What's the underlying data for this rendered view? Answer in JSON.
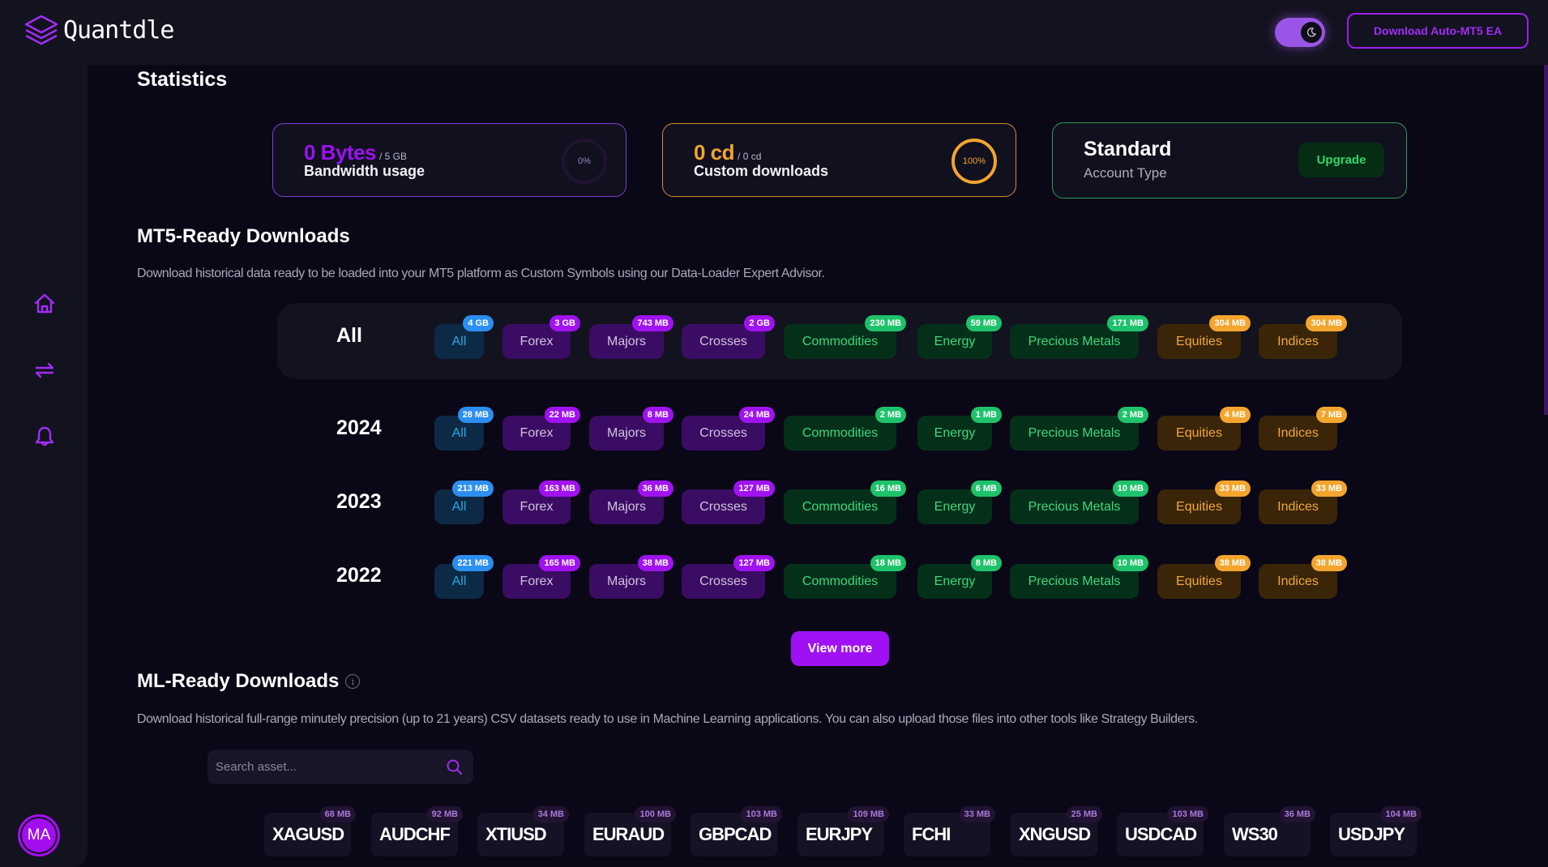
{
  "header": {
    "app_name": "Quantdle",
    "download_ea_label": "Download Auto-MT5 EA",
    "theme": "dark"
  },
  "sidebar": {
    "items": [
      {
        "icon": "home-icon"
      },
      {
        "icon": "transfer-icon"
      },
      {
        "icon": "bell-icon"
      }
    ],
    "avatar_initials": "MA"
  },
  "statistics": {
    "title": "Statistics",
    "bandwidth": {
      "value": "0 Bytes",
      "limit": "/ 5 GB",
      "label": "Bandwidth usage",
      "percent": "0%"
    },
    "custom_downloads": {
      "value": "0 cd",
      "limit": "/ 0 cd",
      "label": "Custom downloads",
      "percent": "100%"
    },
    "account": {
      "type": "Standard",
      "label": "Account Type",
      "upgrade_label": "Upgrade"
    }
  },
  "mt5": {
    "title": "MT5-Ready Downloads",
    "description": "Download historical data ready to be loaded into your MT5 platform as Custom Symbols using our Data-Loader Expert Advisor.",
    "categories": [
      "All",
      "Forex",
      "Majors",
      "Crosses",
      "Commodities",
      "Energy",
      "Precious Metals",
      "Equities",
      "Indices"
    ],
    "rows": [
      {
        "label": "All",
        "sizes": [
          "4 GB",
          "3 GB",
          "743 MB",
          "2 GB",
          "230 MB",
          "59 MB",
          "171 MB",
          "304 MB",
          "304 MB"
        ]
      },
      {
        "label": "2024",
        "sizes": [
          "28 MB",
          "22 MB",
          "8 MB",
          "24 MB",
          "2 MB",
          "1 MB",
          "2 MB",
          "4 MB",
          "7 MB"
        ]
      },
      {
        "label": "2023",
        "sizes": [
          "213 MB",
          "163 MB",
          "36 MB",
          "127 MB",
          "16 MB",
          "6 MB",
          "10 MB",
          "33 MB",
          "33 MB"
        ]
      },
      {
        "label": "2022",
        "sizes": [
          "221 MB",
          "165 MB",
          "38 MB",
          "127 MB",
          "18 MB",
          "8 MB",
          "10 MB",
          "38 MB",
          "38 MB"
        ]
      }
    ],
    "view_more_label": "View more"
  },
  "ml": {
    "title": "ML-Ready Downloads",
    "description": "Download historical full-range minutely precision (up to 21 years) CSV datasets ready to use in Machine Learning applications. You can also upload those files into other tools like Strategy Builders.",
    "search_placeholder": "Search asset...",
    "search_value": "",
    "assets": [
      {
        "name": "XAGUSD",
        "size": "68 MB"
      },
      {
        "name": "AUDCHF",
        "size": "92 MB"
      },
      {
        "name": "XTIUSD",
        "size": "34 MB"
      },
      {
        "name": "EURAUD",
        "size": "100 MB"
      },
      {
        "name": "GBPCAD",
        "size": "103 MB"
      },
      {
        "name": "EURJPY",
        "size": "109 MB"
      },
      {
        "name": "FCHI",
        "size": "33 MB"
      },
      {
        "name": "XNGUSD",
        "size": "25 MB"
      },
      {
        "name": "USDCAD",
        "size": "103 MB"
      },
      {
        "name": "WS30",
        "size": "36 MB"
      },
      {
        "name": "USDJPY",
        "size": "104 MB"
      }
    ]
  },
  "colors": {
    "accent": "#a010f5",
    "all": "#2c8ef0",
    "forex": "#a012f0",
    "commodities": "#1ec26a",
    "equities": "#f4a52e"
  }
}
